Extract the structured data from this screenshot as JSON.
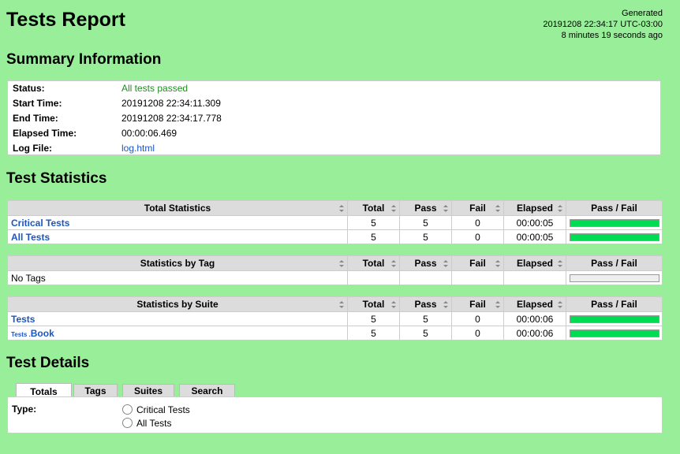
{
  "header": {
    "title": "Tests Report",
    "generated_label": "Generated",
    "generated_time": "20191208 22:34:17 UTC-03:00",
    "generated_ago": "8 minutes 19 seconds ago"
  },
  "summary": {
    "heading": "Summary Information",
    "rows": [
      {
        "label": "Status:",
        "value": "All tests passed"
      },
      {
        "label": "Start Time:",
        "value": "20191208 22:34:11.309"
      },
      {
        "label": "End Time:",
        "value": "20191208 22:34:17.778"
      },
      {
        "label": "Elapsed Time:",
        "value": "00:00:06.469"
      },
      {
        "label": "Log File:",
        "value": "log.html"
      }
    ]
  },
  "statistics": {
    "heading": "Test Statistics",
    "columns": [
      "Total",
      "Pass",
      "Fail",
      "Elapsed",
      "Pass / Fail"
    ],
    "total": {
      "title": "Total Statistics",
      "rows": [
        {
          "name": "Critical Tests",
          "total": "5",
          "pass": "5",
          "fail": "0",
          "elapsed": "00:00:05",
          "pass_ratio": 1.0
        },
        {
          "name": "All Tests",
          "total": "5",
          "pass": "5",
          "fail": "0",
          "elapsed": "00:00:05",
          "pass_ratio": 1.0
        }
      ]
    },
    "tag": {
      "title": "Statistics by Tag",
      "rows": [
        {
          "name": "No Tags",
          "total": "",
          "pass": "",
          "fail": "",
          "elapsed": "",
          "pass_ratio": 0
        }
      ]
    },
    "suite": {
      "title": "Statistics by Suite",
      "rows": [
        {
          "name": "Tests",
          "total": "5",
          "pass": "5",
          "fail": "0",
          "elapsed": "00:00:06",
          "pass_ratio": 1.0
        },
        {
          "prefix": "Tests .",
          "name": "Book",
          "total": "5",
          "pass": "5",
          "fail": "0",
          "elapsed": "00:00:06",
          "pass_ratio": 1.0
        }
      ]
    }
  },
  "details": {
    "heading": "Test Details",
    "tabs": [
      "Totals",
      "Tags",
      "Suites",
      "Search"
    ],
    "active_tab": "Totals",
    "type_label": "Type:",
    "options": [
      "Critical Tests",
      "All Tests"
    ]
  },
  "colors": {
    "background": "#99ee99",
    "pass_bar": "#00dd55",
    "link": "#1a56c4",
    "pass_text": "#1e8e1e"
  }
}
